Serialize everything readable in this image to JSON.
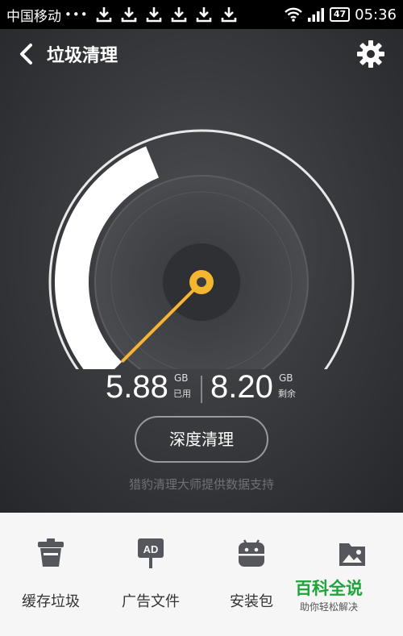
{
  "status_bar": {
    "carrier": "中国移动",
    "dots": "•••",
    "battery": "47",
    "time": "05:36"
  },
  "header": {
    "title": "垃圾清理"
  },
  "storage": {
    "used_value": "5.88",
    "used_unit": "GB",
    "used_label": "已用",
    "remaining_value": "8.20",
    "remaining_unit": "GB",
    "remaining_label": "剩余",
    "used_fraction": 0.4176
  },
  "actions": {
    "deep_clean_label": "深度清理",
    "support_text": "猎豹清理大师提供数据支持"
  },
  "tools": [
    {
      "label": "缓存垃圾",
      "icon": "trash-icon"
    },
    {
      "label": "广告文件",
      "icon": "ad-sign-icon"
    },
    {
      "label": "安装包",
      "icon": "android-icon"
    },
    {
      "label": "",
      "icon": "image-folder-icon"
    }
  ],
  "watermark": {
    "title": "百科全说",
    "subtitle": "助你轻松解决"
  },
  "colors": {
    "accent": "#f5b52e",
    "panel_bg": "#3a3b3f",
    "bottom_bg": "#f6f6f6",
    "watermark_green": "#1ea43a"
  }
}
